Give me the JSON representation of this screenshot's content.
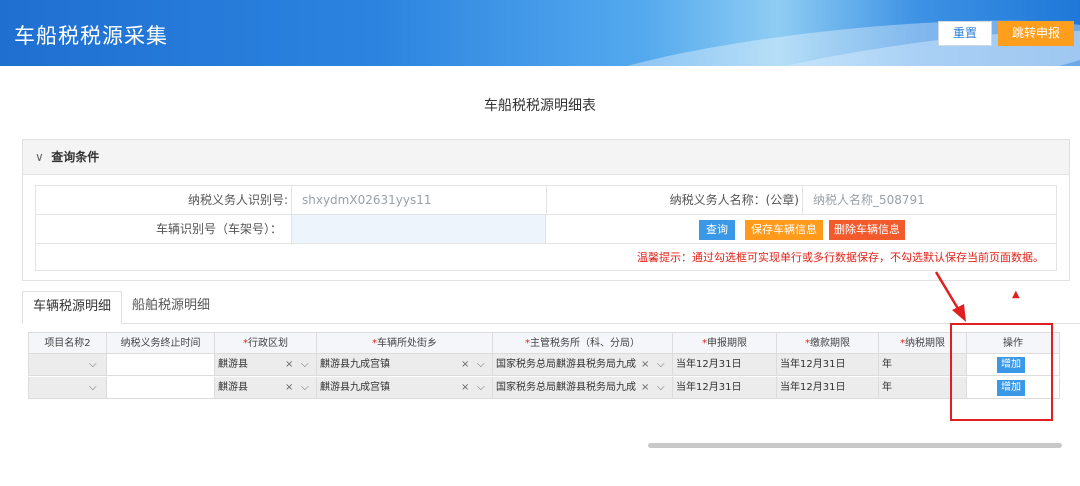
{
  "header": {
    "title": "车船税税源采集",
    "reset_label": "重置",
    "jump_label": "跳转申报"
  },
  "page_title": "车船税税源明细表",
  "query": {
    "panel_title": "查询条件",
    "taxpayer_id_label": "纳税义务人识别号:",
    "taxpayer_id_value": "shxydmX02631yys11",
    "taxpayer_name_label": "纳税义务人名称：(公章)",
    "taxpayer_name_value": "纳税人名称_508791",
    "vin_label": "车辆识别号（车架号）：",
    "vin_value": "",
    "query_btn": "查询",
    "save_btn": "保存车辆信息",
    "delete_btn": "删除车辆信息",
    "tip": "温馨提示：通过勾选框可实现单行或多行数据保存，不勾选默认保存当前页面数据。"
  },
  "tabs": [
    {
      "label": "车辆税源明细",
      "active": true
    },
    {
      "label": "船舶税源明细",
      "active": false
    }
  ],
  "table": {
    "headers": [
      {
        "label": "项目名称2",
        "required": false
      },
      {
        "label": "纳税义务终止时间",
        "required": false
      },
      {
        "label": "行政区划",
        "required": true
      },
      {
        "label": "车辆所处街乡",
        "required": true
      },
      {
        "label": "主管税务所（科、分局）",
        "required": true
      },
      {
        "label": "申报期限",
        "required": true
      },
      {
        "label": "缴款期限",
        "required": true
      },
      {
        "label": "纳税期限",
        "required": true
      },
      {
        "label": "操作",
        "required": false
      }
    ],
    "required_mark": "*",
    "rows": [
      {
        "project": "",
        "end_time": "",
        "region": "麒游县",
        "street": "麒游县九成宫镇",
        "office": "国家税务总局麒游县税务局九成",
        "declare_deadline": "当年12月31日",
        "pay_deadline": "当年12月31日",
        "tax_period": "年",
        "action": "增加"
      },
      {
        "project": "",
        "end_time": "",
        "region": "麒游县",
        "street": "麒游县九成宫镇",
        "office": "国家税务总局麒游县税务局九成",
        "declare_deadline": "当年12月31日",
        "pay_deadline": "当年12月31日",
        "tax_period": "年",
        "action": "增加"
      }
    ]
  },
  "glyphs": {
    "chevron_down": "∨",
    "chevron_select": "⌵",
    "clear": "×",
    "sort_up": "▲"
  },
  "colors": {
    "primary": "#3a98e6",
    "orange": "#ff9a1a",
    "danger": "#f25a2c",
    "annotation": "#e02020"
  }
}
